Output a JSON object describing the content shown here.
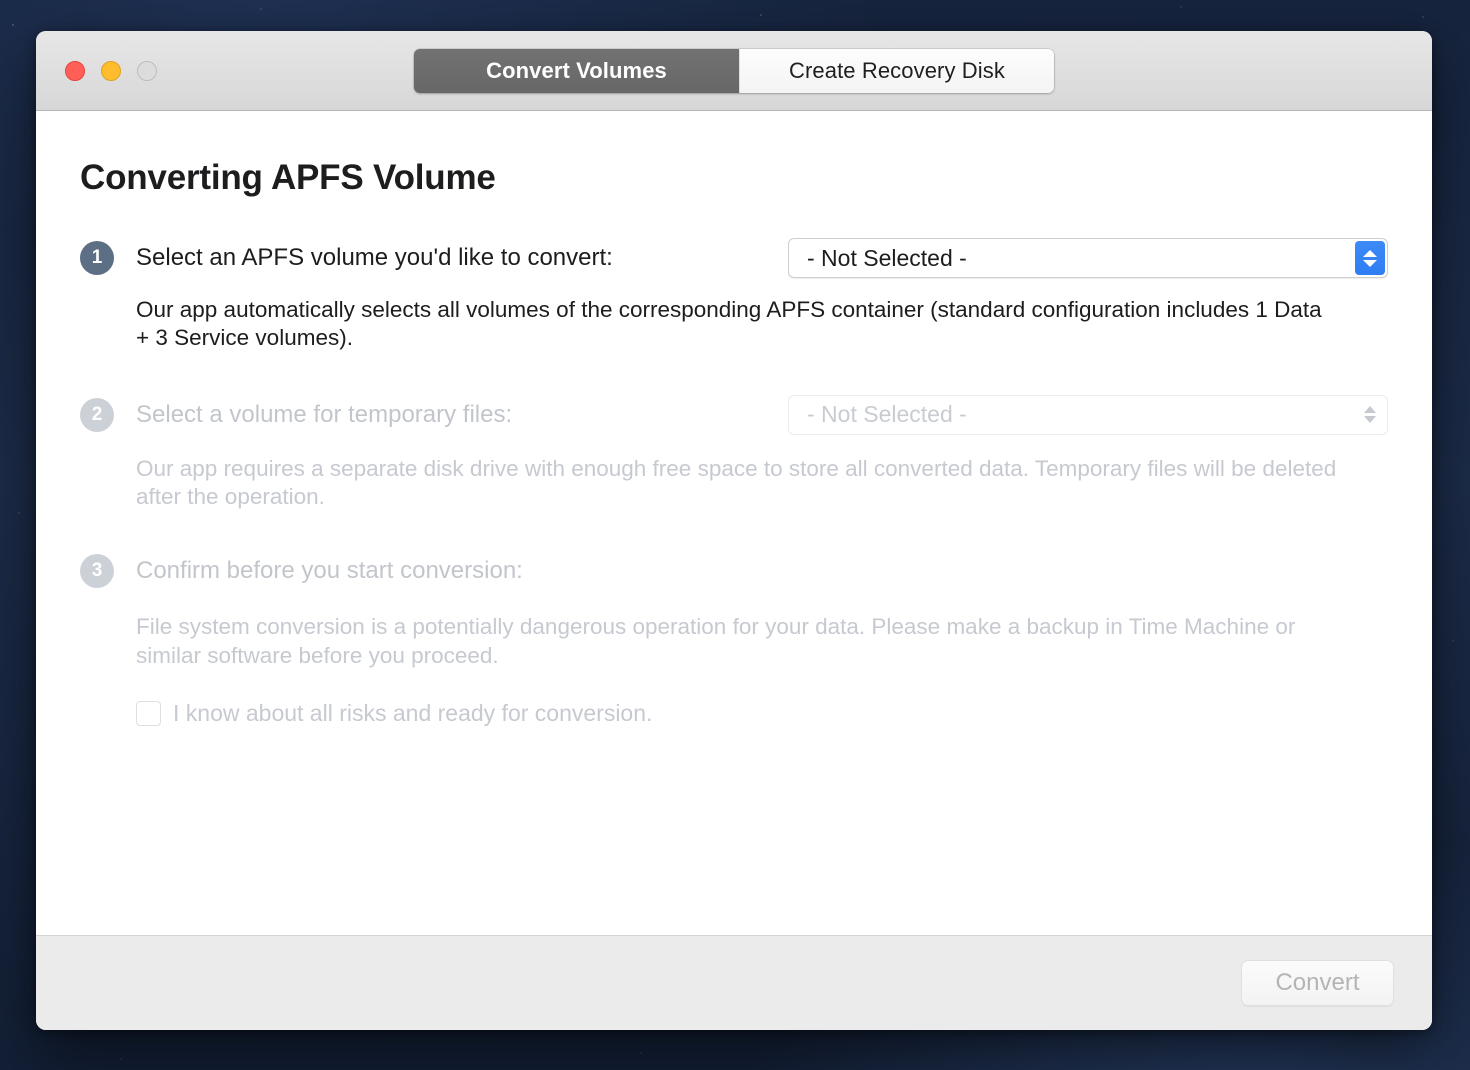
{
  "window": {
    "traffic_lights": [
      {
        "name": "close",
        "color": "#ff5f57"
      },
      {
        "name": "minimize",
        "color": "#ffbd2e"
      },
      {
        "name": "zoom",
        "color": "#dcdcdc"
      }
    ],
    "tabs": [
      {
        "label": "Convert Volumes",
        "selected": true
      },
      {
        "label": "Create Recovery Disk",
        "selected": false
      }
    ]
  },
  "main": {
    "title": "Converting APFS Volume",
    "steps": [
      {
        "number": "1",
        "label": "Select an APFS volume you'd like to convert:",
        "select_value": "- Not Selected -",
        "description": "Our app automatically selects all volumes of the corresponding APFS container (standard configuration includes 1 Data + 3 Service volumes).",
        "enabled": true
      },
      {
        "number": "2",
        "label": "Select a volume for temporary files:",
        "select_value": "- Not Selected -",
        "description": "Our app requires a separate disk drive with enough free space to store all converted data. Temporary files will be deleted after the operation.",
        "enabled": false
      },
      {
        "number": "3",
        "label": "Confirm before you start conversion:",
        "description": "File system conversion is a potentially dangerous operation for your data. Please make a backup in Time Machine or similar software before you proceed.",
        "checkbox_label": "I know about all risks and ready for conversion.",
        "checkbox_checked": false,
        "enabled": false
      }
    ]
  },
  "footer": {
    "convert_label": "Convert",
    "convert_enabled": false
  },
  "colors": {
    "accent_blue": "#2f7df2",
    "badge_active": "#5d6f84",
    "badge_inactive": "#ccd1d7",
    "tab_active_bg": "#6b6b6b",
    "desktop": "#1c2c49"
  }
}
